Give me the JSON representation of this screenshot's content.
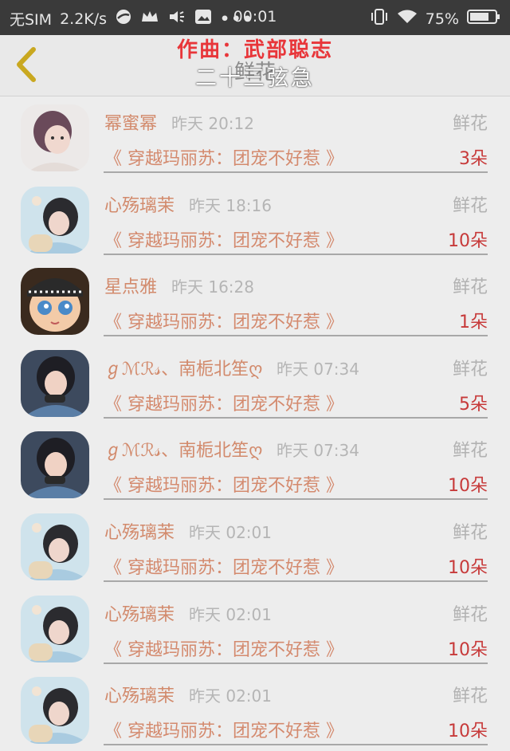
{
  "status_bar": {
    "carrier": "无SIM",
    "speed": "2.2K/s",
    "time": "00:01",
    "battery": "75%",
    "more": "•••"
  },
  "header": {
    "title": "鲜花",
    "lyric_line1": "作曲：武部聪志",
    "lyric_line2": "二十三弦急"
  },
  "items": [
    {
      "user": "幂蜜幂",
      "time": "昨天 20:12",
      "gift": "鲜花",
      "book": "《 穿越玛丽苏：团宠不好惹 》",
      "count": "3朵",
      "avatar": "avatar-a"
    },
    {
      "user": "心殇璃茉",
      "time": "昨天 18:16",
      "gift": "鲜花",
      "book": "《 穿越玛丽苏：团宠不好惹 》",
      "count": "10朵",
      "avatar": "avatar-b"
    },
    {
      "user": "星点雅",
      "time": "昨天 16:28",
      "gift": "鲜花",
      "book": "《 穿越玛丽苏：团宠不好惹 》",
      "count": "1朵",
      "avatar": "avatar-c"
    },
    {
      "user": "ℊℳℛ𝓈、南栀北笙ღ",
      "time": "昨天 07:34",
      "gift": "鲜花",
      "book": "《 穿越玛丽苏：团宠不好惹 》",
      "count": "5朵",
      "avatar": "avatar-d"
    },
    {
      "user": "ℊℳℛ𝓈、南栀北笙ღ",
      "time": "昨天 07:34",
      "gift": "鲜花",
      "book": "《 穿越玛丽苏：团宠不好惹 》",
      "count": "10朵",
      "avatar": "avatar-d"
    },
    {
      "user": "心殇璃茉",
      "time": "昨天 02:01",
      "gift": "鲜花",
      "book": "《 穿越玛丽苏：团宠不好惹 》",
      "count": "10朵",
      "avatar": "avatar-b"
    },
    {
      "user": "心殇璃茉",
      "time": "昨天 02:01",
      "gift": "鲜花",
      "book": "《 穿越玛丽苏：团宠不好惹 》",
      "count": "10朵",
      "avatar": "avatar-b"
    },
    {
      "user": "心殇璃茉",
      "time": "昨天 02:01",
      "gift": "鲜花",
      "book": "《 穿越玛丽苏：团宠不好惹 》",
      "count": "10朵",
      "avatar": "avatar-b"
    }
  ],
  "colors": {
    "accent_red": "#c73a3a",
    "lyric_red": "#e8363a",
    "back_arrow": "#c9a820"
  }
}
